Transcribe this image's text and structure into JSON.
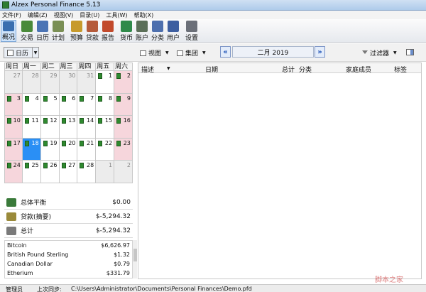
{
  "window": {
    "title": "Alzex Personal Finance 5.13"
  },
  "menu": [
    "文件(F)",
    "编辑(Z)",
    "视图(V)",
    "目录(U)",
    "工具(W)",
    "帮助(X)"
  ],
  "toolbar": [
    {
      "label": "概况",
      "icon": "overview-icon",
      "color": "#3a6fb0"
    },
    {
      "label": "交易",
      "icon": "transactions-icon",
      "color": "#4a8a3a"
    },
    {
      "label": "日历",
      "icon": "calendar-icon",
      "color": "#4b74b5"
    },
    {
      "label": "计划",
      "icon": "plan-icon",
      "color": "#7a8f55"
    },
    {
      "label": "预算",
      "icon": "budget-icon",
      "color": "#c79a2b"
    },
    {
      "label": "贷款",
      "icon": "loan-icon",
      "color": "#b55a3a"
    },
    {
      "label": "报告",
      "icon": "report-icon",
      "color": "#c24a2c"
    },
    {
      "label": "货币",
      "icon": "currency-icon",
      "color": "#2f8a4a"
    },
    {
      "label": "账户",
      "icon": "accounts-icon",
      "color": "#5b6f58"
    },
    {
      "label": "分类",
      "icon": "categories-icon",
      "color": "#4d6fae"
    },
    {
      "label": "用户",
      "icon": "users-icon",
      "color": "#3d5ea0"
    },
    {
      "label": "设置",
      "icon": "settings-icon",
      "color": "#6b6f78"
    }
  ],
  "viewbar": {
    "calendar_view": "日历",
    "view_menu": "视图",
    "group_menu": "集团",
    "month": "二月 2019",
    "filter": "过滤器"
  },
  "calendar": {
    "weekdays": [
      "周日",
      "周一",
      "周二",
      "周三",
      "周四",
      "周五",
      "周六"
    ],
    "weeks": [
      [
        {
          "d": "27",
          "t": "other"
        },
        {
          "d": "28",
          "t": "other"
        },
        {
          "d": "29",
          "t": "other"
        },
        {
          "d": "30",
          "t": "other"
        },
        {
          "d": "31",
          "t": "other"
        },
        {
          "d": "1",
          "t": "mark"
        },
        {
          "d": "2",
          "t": "weekend-mark"
        }
      ],
      [
        {
          "d": "3",
          "t": "weekend-mark"
        },
        {
          "d": "4",
          "t": "mark"
        },
        {
          "d": "5",
          "t": "mark"
        },
        {
          "d": "6",
          "t": "mark"
        },
        {
          "d": "7",
          "t": "mark"
        },
        {
          "d": "8",
          "t": "mark"
        },
        {
          "d": "9",
          "t": "weekend-mark"
        }
      ],
      [
        {
          "d": "10",
          "t": "weekend-mark"
        },
        {
          "d": "11",
          "t": "mark"
        },
        {
          "d": "12",
          "t": "mark"
        },
        {
          "d": "13",
          "t": "mark"
        },
        {
          "d": "14",
          "t": "mark"
        },
        {
          "d": "15",
          "t": "mark"
        },
        {
          "d": "16",
          "t": "weekend-mark"
        }
      ],
      [
        {
          "d": "17",
          "t": "weekend-mark"
        },
        {
          "d": "18",
          "t": "selected-mark"
        },
        {
          "d": "19",
          "t": "mark"
        },
        {
          "d": "20",
          "t": "mark"
        },
        {
          "d": "21",
          "t": "mark"
        },
        {
          "d": "22",
          "t": "mark"
        },
        {
          "d": "23",
          "t": "weekend-mark"
        }
      ],
      [
        {
          "d": "24",
          "t": "weekend-mark"
        },
        {
          "d": "25",
          "t": "mark"
        },
        {
          "d": "26",
          "t": "mark"
        },
        {
          "d": "27",
          "t": "mark"
        },
        {
          "d": "28",
          "t": "mark"
        },
        {
          "d": "1",
          "t": "other"
        },
        {
          "d": "2",
          "t": "other"
        }
      ]
    ]
  },
  "totals": [
    {
      "label": "总体平衡",
      "value": "$0.00",
      "icon": "balance-icon",
      "color": "#3a7a3a"
    },
    {
      "label": "贷款(摘要)",
      "value": "$-5,294.32",
      "icon": "loan-summary-icon",
      "color": "#9a8a3a"
    },
    {
      "label": "总计",
      "value": "$-5,294.32",
      "icon": "scales-icon",
      "color": "#7a7a7a"
    }
  ],
  "currencies": [
    {
      "name": "Bitcoin",
      "value": "$6,626.97"
    },
    {
      "name": "British Pound Sterling",
      "value": "$1.32"
    },
    {
      "name": "Canadian Dollar",
      "value": "$0.79"
    },
    {
      "name": "Etherium",
      "value": "$331.79"
    }
  ],
  "list_columns": {
    "description": "描述",
    "date": "日期",
    "total": "总计",
    "category": "分类",
    "member": "家庭成员",
    "tag": "标签"
  },
  "statusbar": {
    "user": "管理员",
    "sync": "上次同步:",
    "path": "C:\\Users\\Administrator\\Documents\\Personal Finances\\Demo.pfd"
  },
  "watermark": "脚本之家"
}
